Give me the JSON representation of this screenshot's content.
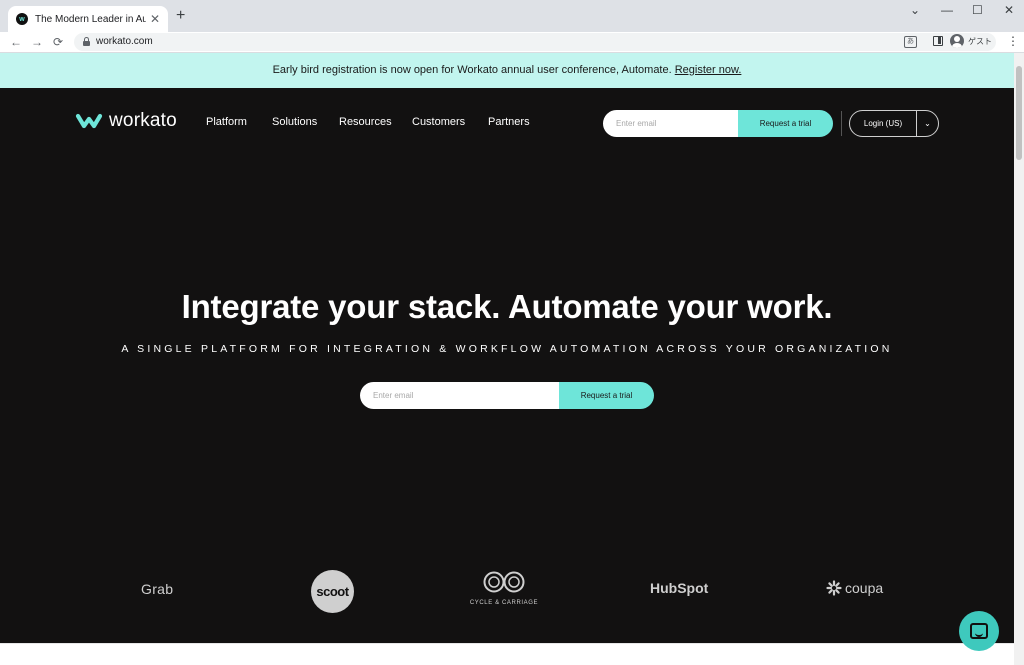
{
  "browser": {
    "tab_title": "The Modern Leader in Automation",
    "tab_favicon_letter": "w",
    "tab_close": "✕",
    "new_tab": "+",
    "url": "workato.com",
    "translate_glyph": "あ",
    "profile_label": "ゲスト",
    "back": "←",
    "forward": "→",
    "reload": "⟳",
    "menu": "⋮",
    "minimize": "—",
    "maximize": "☐",
    "close": "✕",
    "tab_search": "⌄"
  },
  "announcement": {
    "text": "Early bird registration is now open for Workato annual user conference, Automate.",
    "link": "Register now."
  },
  "header": {
    "logo_text": "workato",
    "nav": [
      "Platform",
      "Solutions",
      "Resources",
      "Customers",
      "Partners"
    ],
    "email_placeholder": "Enter email",
    "trial_button": "Request a trial",
    "login_label": "Login (US)",
    "login_chevron": "⌄"
  },
  "hero": {
    "title": "Integrate your stack. Automate your work.",
    "subtitle": "A SINGLE PLATFORM FOR INTEGRATION & WORKFLOW AUTOMATION ACROSS YOUR ORGANIZATION",
    "email_placeholder": "Enter email",
    "trial_button": "Request a trial"
  },
  "customers": {
    "grab": "Grab",
    "scoot": "scoot",
    "cycle_carriage": "CYCLE & CARRIAGE",
    "hubspot": "HubSpot",
    "coupa": "coupa"
  },
  "icons": {
    "logo": "workato-logo-icon",
    "chat": "chat-bubble-icon",
    "lock": "lock-icon"
  },
  "colors": {
    "accent": "#6ee5d9",
    "banner": "#c2f5ef",
    "background": "#121111",
    "chat_button": "#3ec9bd"
  }
}
